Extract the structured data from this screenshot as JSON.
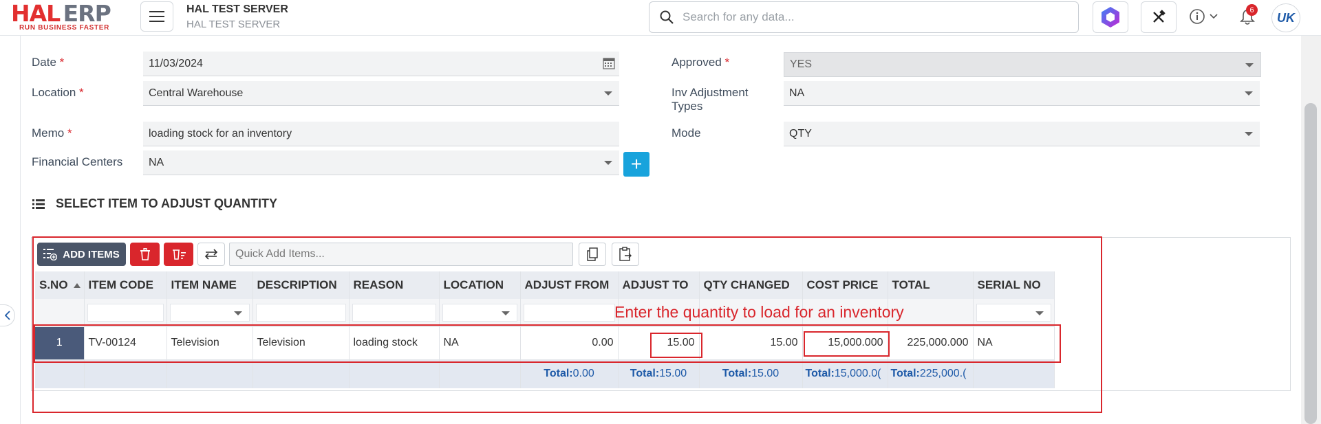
{
  "header": {
    "logo_main": "HAL",
    "logo_second": "ERP",
    "logo_tagline": "RUN BUSINESS FASTER",
    "server_title": "HAL TEST SERVER",
    "server_subtitle": "HAL TEST SERVER",
    "search_placeholder": "Search for any data...",
    "notification_count": "6",
    "avatar_initials": "UK"
  },
  "form": {
    "date_label": "Date",
    "date_value": "11/03/2024",
    "location_label": "Location",
    "location_value": "Central Warehouse",
    "memo_label": "Memo",
    "memo_value": "loading stock for an inventory",
    "financial_centers_label": "Financial Centers",
    "financial_centers_value": "NA",
    "approved_label": "Approved",
    "approved_value": "YES",
    "inv_adjustment_types_label_line1": "Inv Adjustment",
    "inv_adjustment_types_label_line2": "Types",
    "inv_adjustment_types_value": "NA",
    "mode_label": "Mode",
    "mode_value": "QTY",
    "required_mark": "*",
    "add_button_label": "+"
  },
  "section": {
    "title": "SELECT ITEM TO ADJUST QUANTITY"
  },
  "toolbar": {
    "add_items_label": "ADD ITEMS",
    "quick_add_placeholder": "Quick Add Items..."
  },
  "grid": {
    "columns": [
      "S.NO",
      "ITEM CODE",
      "ITEM NAME",
      "DESCRIPTION",
      "REASON",
      "LOCATION",
      "ADJUST FROM",
      "ADJUST TO",
      "QTY CHANGED",
      "COST PRICE",
      "TOTAL",
      "SERIAL NO"
    ],
    "rows": [
      {
        "sno": "1",
        "item_code": "TV-00124",
        "item_name": "Television",
        "description": "Television",
        "reason": "loading stock",
        "location": "NA",
        "adjust_from": "0.00",
        "adjust_to": "15.00",
        "qty_changed": "15.00",
        "cost_price": "15,000.000",
        "total": "225,000.000",
        "serial_no": "NA"
      }
    ],
    "totals": {
      "label": "Total:",
      "adjust_from": "0.00",
      "adjust_to": "15.00",
      "qty_changed": "15.00",
      "cost_price": "15,000.0(",
      "total": "225,000.("
    }
  },
  "annotation": {
    "text": "Enter the quantity to load for an inventory",
    "color": "#d9262c"
  }
}
